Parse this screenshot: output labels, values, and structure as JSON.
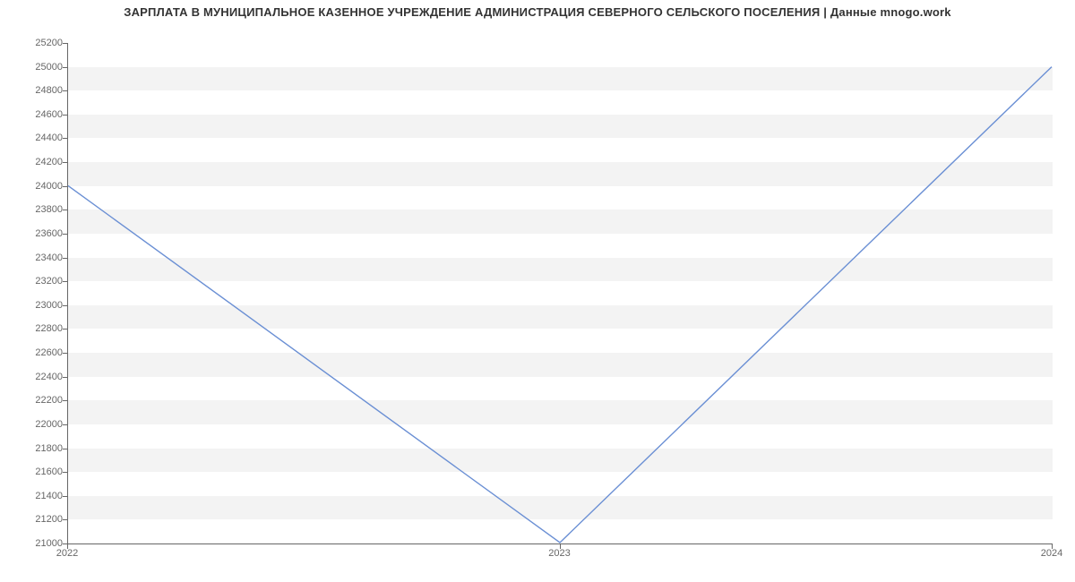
{
  "chart_data": {
    "type": "line",
    "title": "ЗАРПЛАТА В МУНИЦИПАЛЬНОЕ КАЗЕННОЕ УЧРЕЖДЕНИЕ АДМИНИСТРАЦИЯ СЕВЕРНОГО СЕЛЬСКОГО ПОСЕЛЕНИЯ | Данные mnogo.work",
    "x": [
      2022,
      2023,
      2024
    ],
    "values": [
      24000,
      21000,
      25000
    ],
    "x_ticks": [
      2022,
      2023,
      2024
    ],
    "y_ticks": [
      21000,
      21200,
      21400,
      21600,
      21800,
      22000,
      22200,
      22400,
      22600,
      22800,
      23000,
      23200,
      23400,
      23600,
      23800,
      24000,
      24200,
      24400,
      24600,
      24800,
      25000,
      25200
    ],
    "xlim": [
      2022,
      2024
    ],
    "ylim": [
      21000,
      25200
    ],
    "xlabel": "",
    "ylabel": "",
    "line_color": "#6a8fd4",
    "band_color": "#f3f3f3",
    "grid": true
  }
}
